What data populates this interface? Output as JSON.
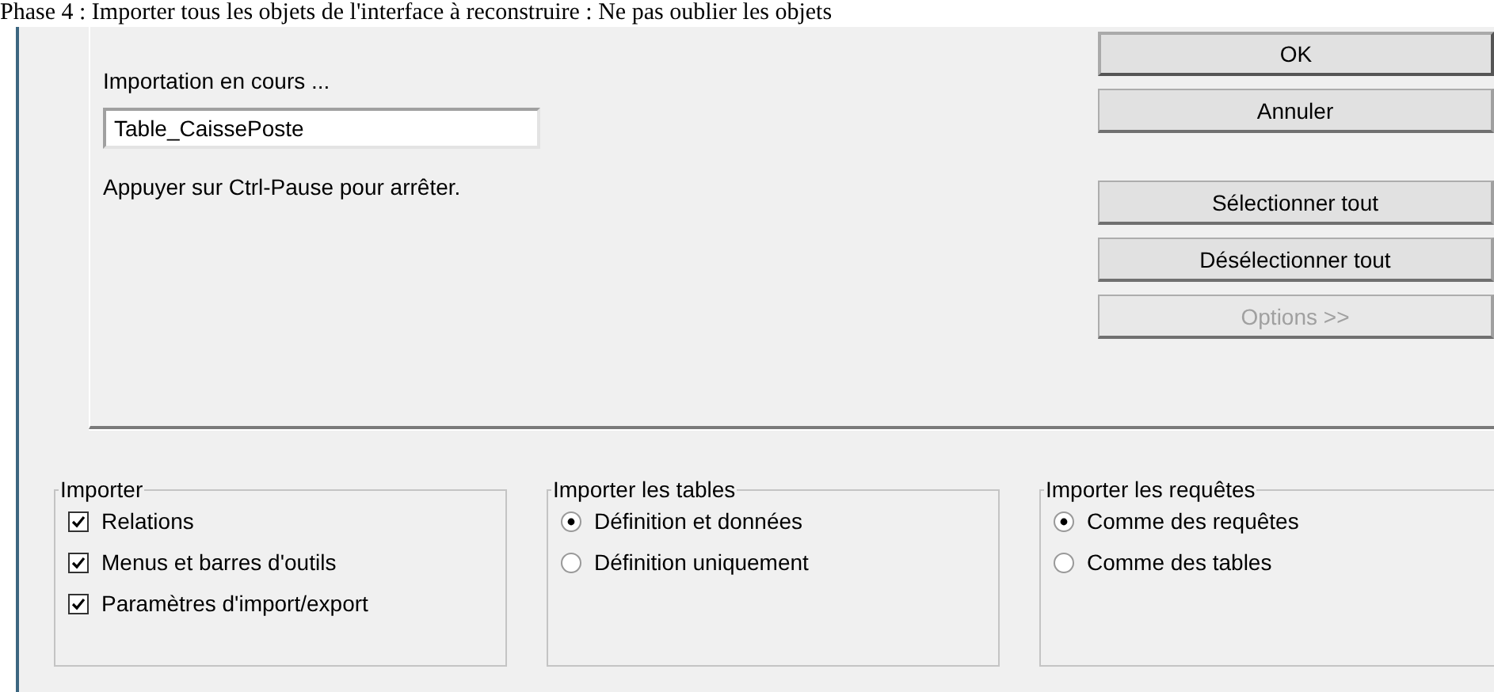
{
  "heading": "Phase 4 : Importer tous les objets de l'interface à reconstruire : Ne pas oublier les objets",
  "progress": {
    "label": "Importation en cours ...",
    "value": "Table_CaissePoste",
    "hint": "Appuyer sur Ctrl-Pause pour arrêter."
  },
  "buttons": [
    {
      "label": "OK",
      "disabled": false,
      "default": true
    },
    {
      "label": "Annuler",
      "disabled": false,
      "default": false
    },
    {
      "label": "Sélectionner tout",
      "disabled": false,
      "default": false
    },
    {
      "label": "Désélectionner tout",
      "disabled": false,
      "default": false
    },
    {
      "label": "Options >>",
      "disabled": true,
      "default": false
    }
  ],
  "groups": [
    {
      "title": "Importer",
      "items": [
        {
          "kind": "checkbox",
          "label": "Relations",
          "checked": true
        },
        {
          "kind": "checkbox",
          "label": "Menus et barres d'outils",
          "checked": true
        },
        {
          "kind": "checkbox",
          "label": "Paramètres d'import/export",
          "checked": true
        }
      ]
    },
    {
      "title": "Importer les tables",
      "items": [
        {
          "kind": "radio",
          "label": "Définition et données",
          "selected": true
        },
        {
          "kind": "radio",
          "label": "Définition uniquement",
          "selected": false
        }
      ]
    },
    {
      "title": "Importer les requêtes",
      "items": [
        {
          "kind": "radio",
          "label": "Comme des requêtes",
          "selected": true
        },
        {
          "kind": "radio",
          "label": "Comme des tables",
          "selected": false
        }
      ]
    }
  ]
}
